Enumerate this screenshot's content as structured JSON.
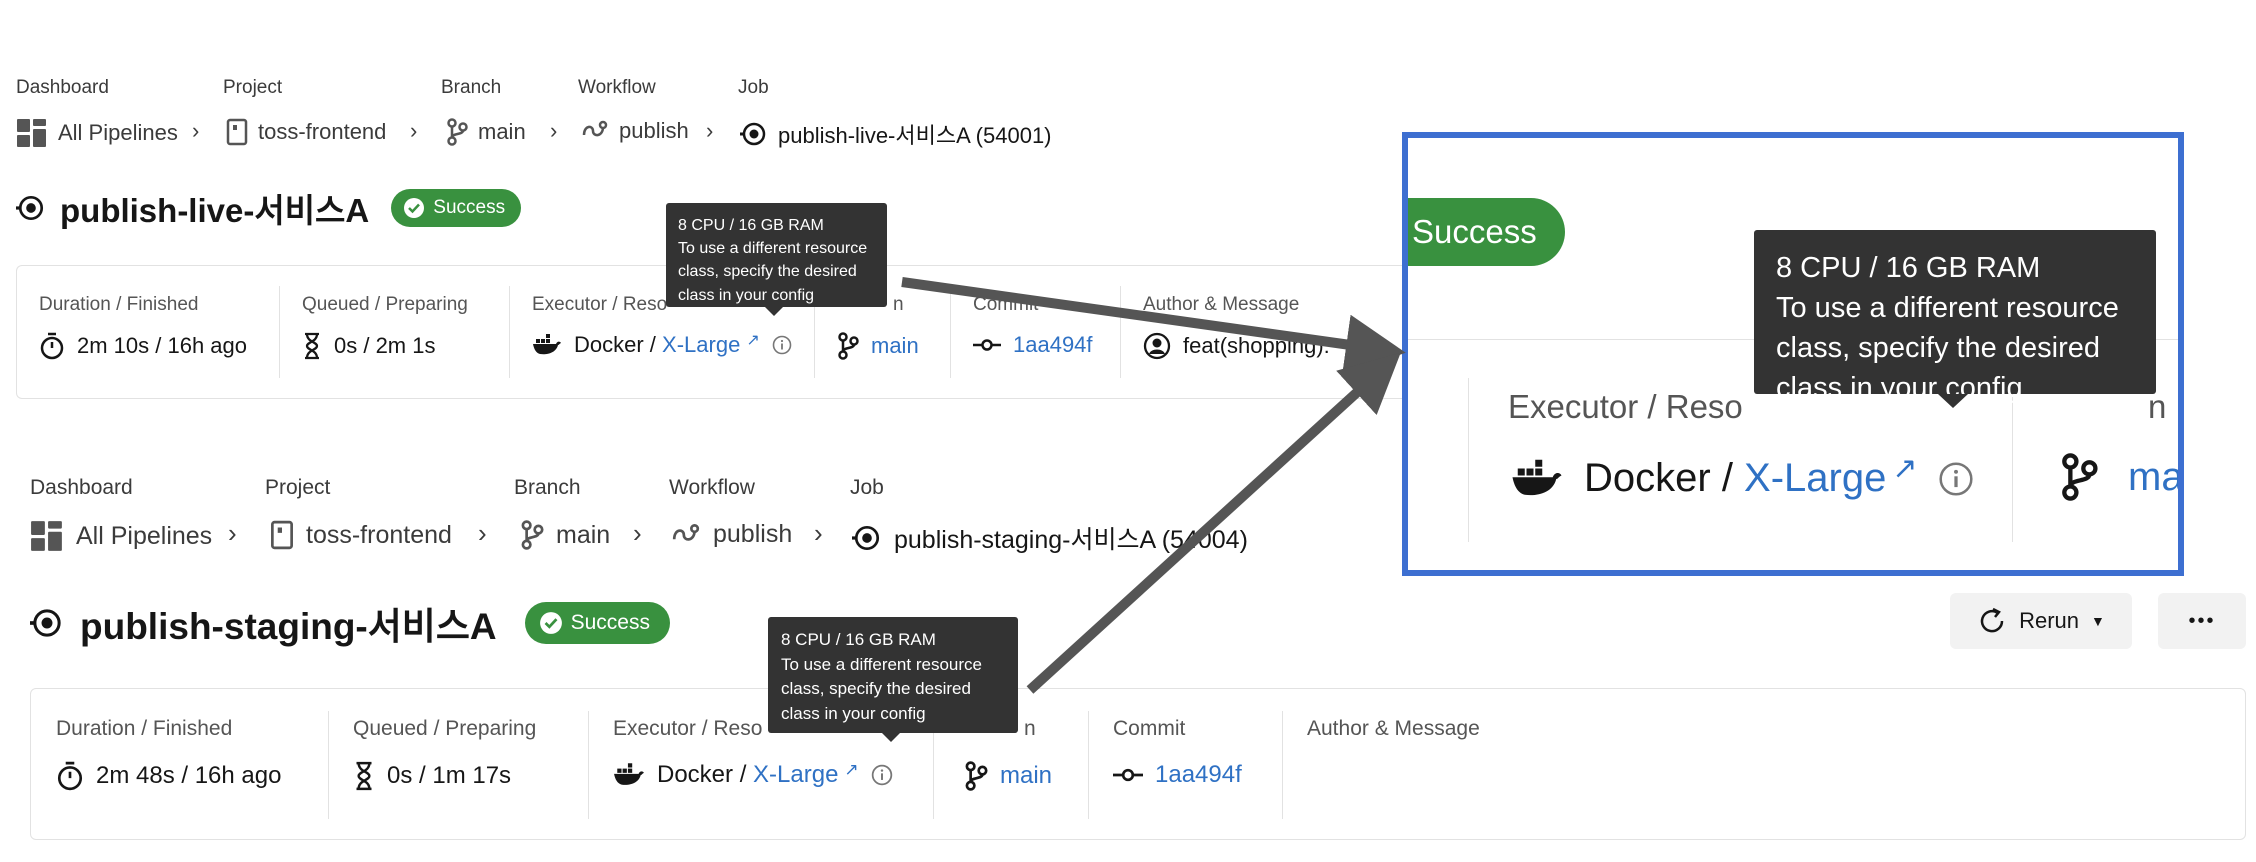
{
  "breadcrumb_labels": {
    "dashboard": "Dashboard",
    "project": "Project",
    "branch": "Branch",
    "workflow": "Workflow",
    "job": "Job"
  },
  "top": {
    "breadcrumb": {
      "pipelines": "All Pipelines",
      "project": "toss-frontend",
      "branch": "main",
      "workflow": "publish",
      "job": "publish-live-서비스A (54001)"
    },
    "job_title": "publish-live-서비스A",
    "status": "Success",
    "columns": {
      "duration_label": "Duration / Finished",
      "duration_value": "2m 10s / 16h ago",
      "queued_label": "Queued / Preparing",
      "queued_value": "0s / 2m 1s",
      "executor_label": "Executor / Reso",
      "executor_prefix": "Docker / ",
      "executor_class": "X-Large",
      "branch_label": "n",
      "branch_value": "main",
      "commit_label": "Commit",
      "commit_value": "1aa494f",
      "author_label": "Author & Message",
      "author_value": "feat(shopping): "
    }
  },
  "bottom": {
    "breadcrumb": {
      "pipelines": "All Pipelines",
      "project": "toss-frontend",
      "branch": "main",
      "workflow": "publish",
      "job": "publish-staging-서비스A (54004)"
    },
    "job_title": "publish-staging-서비스A",
    "status": "Success",
    "rerun_label": "Rerun",
    "more_label": "•••",
    "columns": {
      "duration_label": "Duration / Finished",
      "duration_value": "2m 48s / 16h ago",
      "queued_label": "Queued / Preparing",
      "queued_value": "0s / 1m 17s",
      "executor_label": "Executor / Reso",
      "executor_prefix": "Docker / ",
      "executor_class": "X-Large",
      "branch_label": "n",
      "branch_value": "main",
      "commit_label": "Commit",
      "commit_value": "1aa494f",
      "author_label": "Author & Message"
    }
  },
  "tooltip": {
    "line1": "8 CPU / 16 GB RAM",
    "line2": "To use a different resource",
    "line3": "class, specify the desired",
    "line4": "class in your config"
  },
  "zoom": {
    "status": "Success",
    "executor_label": "Executor / Reso",
    "branch_label": "n",
    "executor_prefix": "Docker / ",
    "executor_class": "X-Large",
    "branch_value": "ma"
  },
  "colors": {
    "success": "#39913f",
    "link": "#2f71c4",
    "tooltip": "#333333",
    "highlight": "#3d6fd1",
    "arrow": "#555555"
  }
}
